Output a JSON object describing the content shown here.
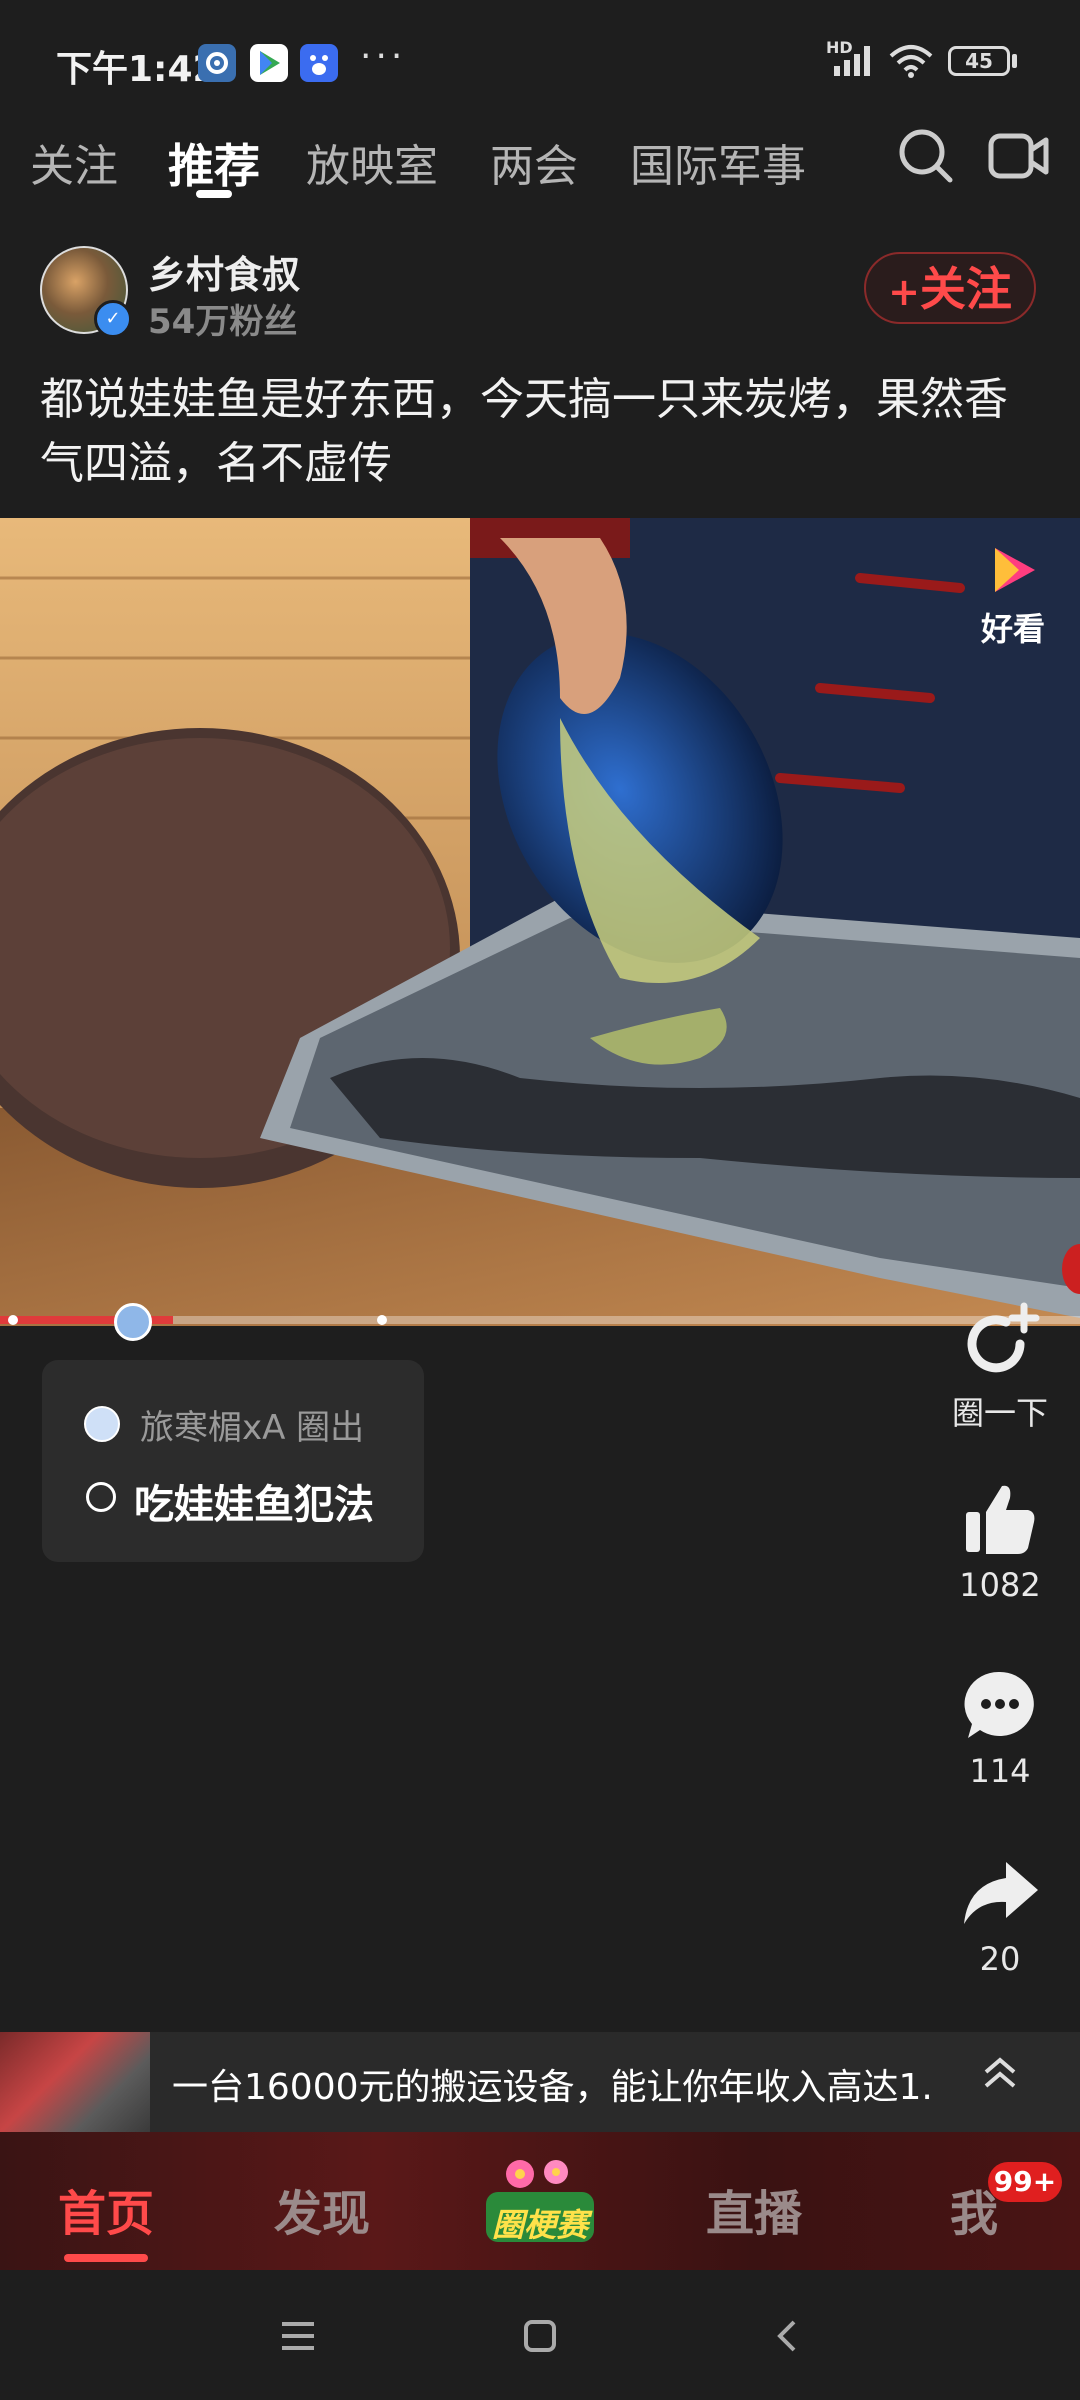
{
  "status_bar": {
    "time": "下午1:42",
    "signal_label": "HD",
    "battery": "45"
  },
  "top_nav": {
    "tabs": [
      {
        "label": "关注",
        "active": false
      },
      {
        "label": "推荐",
        "active": true
      },
      {
        "label": "放映室",
        "active": false
      },
      {
        "label": "两会",
        "active": false
      },
      {
        "label": "国际军事",
        "active": false
      }
    ],
    "search_icon": "search-icon",
    "camera_icon": "video-camera-icon"
  },
  "author": {
    "name": "乡村食叔",
    "fans": "54万粉丝",
    "follow_label": "关注",
    "follow_plus": "+"
  },
  "post": {
    "title": "都说娃娃鱼是好东西，今天搞一只来炭烤，果然香气四溢，名不虚传"
  },
  "video": {
    "watermark": "好看",
    "progress": 0.16
  },
  "circle_card": {
    "user": "旅寒楣xA 圈出",
    "topic": "吃娃娃鱼犯法"
  },
  "actions": {
    "circle_label": "圈一下",
    "likes": "1082",
    "comments": "114",
    "shares": "20"
  },
  "ad": {
    "text": "一台16000元的搬运设备，能让你年收入高达1..."
  },
  "bottom_tabs": {
    "items": [
      {
        "label": "首页",
        "active": true
      },
      {
        "label": "发现",
        "active": false
      },
      {
        "label": "直播",
        "active": false
      },
      {
        "label": "我",
        "active": false
      }
    ],
    "center_logo": "圈梗赛",
    "badge": "99+"
  },
  "colors": {
    "accent": "#ff4a4a",
    "background": "#1e1e1e"
  }
}
